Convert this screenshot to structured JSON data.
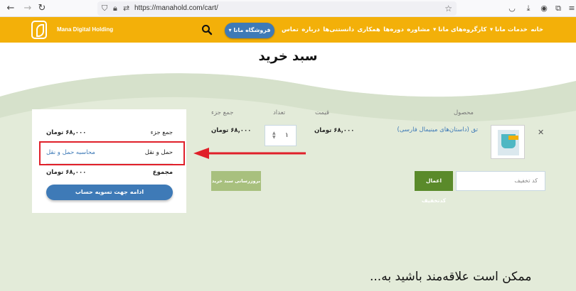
{
  "browser": {
    "url": "https://manahold.com/cart/"
  },
  "header": {
    "brand": "Mana Digital Holding",
    "shop_button": "فروشگاه مانا",
    "menu": [
      "خانه",
      "خدمات مانا",
      "کارگروه‌های مانا",
      "مشاوره",
      "دوره‌ها",
      "همکاری",
      "دانستنی‌ها",
      "درباره",
      "تماس"
    ],
    "colors": {
      "header": "#f3b009",
      "accent": "#3e7ab7"
    }
  },
  "page": {
    "title": "سبد خرید"
  },
  "cart": {
    "headers": {
      "product": "محصول",
      "price": "قیمت",
      "quantity": "تعداد",
      "subtotal": "جمع جزء"
    },
    "item": {
      "name": "تق (داستان‌های مینیمال فارسی)",
      "price": "۶۸,۰۰۰ تومان",
      "quantity": "۱",
      "subtotal": "۶۸,۰۰۰ تومان"
    },
    "coupon_placeholder": "کد تخفیف",
    "apply_coupon": "اعمال کدتخفیف",
    "update_cart": "بروزرسانی سبد خرید"
  },
  "totals": {
    "subtotal_label": "جمع جزء",
    "subtotal_value": "۶۸,۰۰۰ تومان",
    "shipping_label": "حمل و نقل",
    "shipping_link": "محاسبه حمل و نقل",
    "total_label": "مجموع",
    "total_value": "۶۸,۰۰۰ تومان",
    "checkout": "ادامه جهت تسویه حساب"
  },
  "related_heading": "ممکن است علاقه‌مند باشید به..."
}
